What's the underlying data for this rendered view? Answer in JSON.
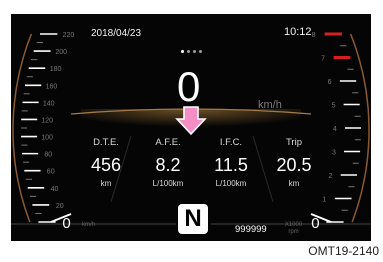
{
  "status_bar": {
    "date": "2018/04/23",
    "time": "10:12"
  },
  "speedometer": {
    "value": "0",
    "unit": "km/h",
    "scale_labels": [
      "220",
      "200",
      "180",
      "160",
      "140",
      "120",
      "100",
      "80",
      "60",
      "40",
      "20",
      "0"
    ],
    "scale_unit": "km/h"
  },
  "tachometer": {
    "value": "0",
    "unit": "X1000 rpm",
    "scale_labels": [
      "8",
      "7",
      "6",
      "5",
      "4",
      "3",
      "2",
      "1",
      "0"
    ],
    "redline_color": "#d71f1f"
  },
  "page_indicator": {
    "count": 4,
    "active": 0
  },
  "info_panel": {
    "highlight_color": "#f58ec5",
    "items": [
      {
        "label": "D.T.E.",
        "value": "456",
        "unit": "km"
      },
      {
        "label": "A.F.E.",
        "value": "8.2",
        "unit": "L/100km"
      },
      {
        "label": "I.F.C.",
        "value": "11.5",
        "unit": "L/100km"
      },
      {
        "label": "Trip",
        "value": "20.5",
        "unit": "km"
      }
    ]
  },
  "gear": "N",
  "odometer": "999999",
  "caption": "OMT19-2140"
}
